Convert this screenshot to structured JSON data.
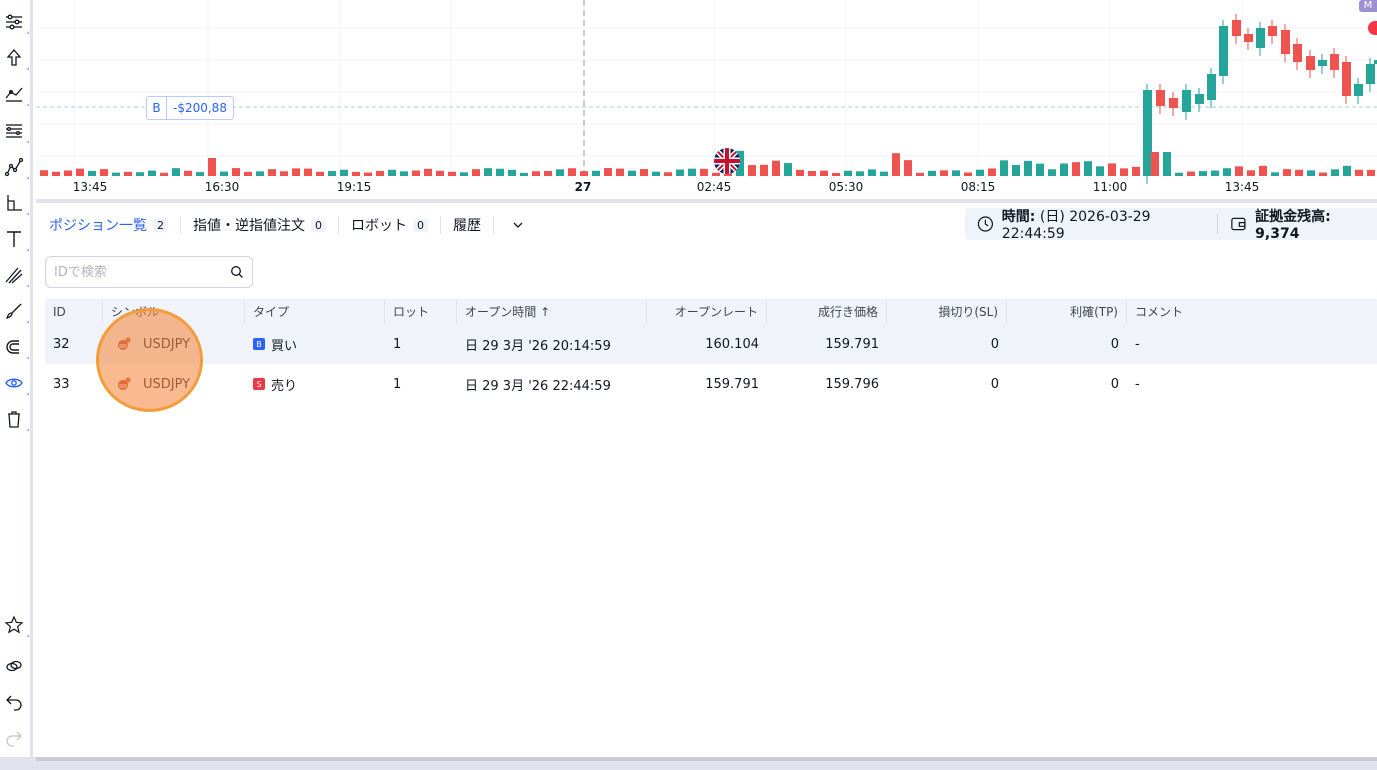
{
  "chart": {
    "time_labels": [
      "13:45",
      "16:30",
      "19:15",
      "27",
      "02:45",
      "05:30",
      "08:15",
      "11:00",
      "13:45"
    ],
    "position_tag": {
      "side": "B",
      "value": "-$200,88"
    },
    "badge_m": "M",
    "colors": {
      "up": "#26a69a",
      "down": "#ef5350",
      "grid": "#f0f3fa",
      "position_line": "#2962ff"
    }
  },
  "tabs": [
    {
      "label": "ポジション一覧",
      "count": "2",
      "active": true
    },
    {
      "label": "指値・逆指値注文",
      "count": "0",
      "active": false
    },
    {
      "label": "ロボット",
      "count": "0",
      "active": false
    },
    {
      "label": "履歴",
      "count": "",
      "active": false
    }
  ],
  "info": {
    "time_label": "時間:",
    "time_value": "(日) 2026-03-29 22:44:59",
    "margin_label": "証拠金残高:",
    "margin_value": "9,374"
  },
  "search": {
    "placeholder": "IDで検索"
  },
  "table": {
    "headers": {
      "id": "ID",
      "symbol": "シンボル",
      "type": "タイプ",
      "lot": "ロット",
      "open_time": "オープン時間 ↑",
      "open_rate": "オープンレート",
      "market_price": "成行き価格",
      "sl": "損切り(SL)",
      "tp": "利確(TP)",
      "comment": "コメント"
    },
    "rows": [
      {
        "id": "32",
        "symbol": "USDJPY",
        "type_badge": "B",
        "type": "買い",
        "lot": "1",
        "open_time": "日 29 3月 '26 20:14:59",
        "open_rate": "160.104",
        "market_price": "159.791",
        "sl": "0",
        "tp": "0",
        "comment": "-"
      },
      {
        "id": "33",
        "symbol": "USDJPY",
        "type_badge": "S",
        "type": "売り",
        "lot": "1",
        "open_time": "日 29 3月 '26 22:44:59",
        "open_rate": "159.791",
        "market_price": "159.796",
        "sl": "0",
        "tp": "0",
        "comment": "-"
      }
    ]
  },
  "toolbar": {
    "icons": [
      "crosshair-settings-icon",
      "arrow-up-icon",
      "trend-line-icon",
      "fib-icon",
      "pattern-icon",
      "measure-icon",
      "text-icon",
      "brush-multi-icon",
      "brush-icon",
      "magnet-icon",
      "eye-icon",
      "trash-icon",
      "star-icon",
      "link-icon",
      "undo-icon",
      "redo-icon"
    ]
  }
}
